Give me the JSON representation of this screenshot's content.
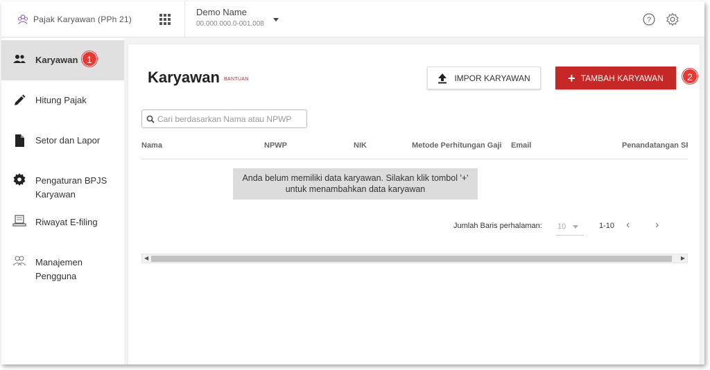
{
  "header": {
    "app_title": "Pajak Karyawan (PPh 21)",
    "company_name": "Demo Name",
    "company_npwp": "00.000.000.0-001.008"
  },
  "sidebar": {
    "items": [
      {
        "label": "Karyawan",
        "icon": "people-icon",
        "active": true,
        "badge": "1"
      },
      {
        "label": "Hitung Pajak",
        "icon": "pencil-icon"
      },
      {
        "label": "Setor dan Lapor",
        "icon": "document-icon"
      },
      {
        "label": "Pengaturan BPJS Karyawan",
        "icon": "gear-icon"
      },
      {
        "label": "Riwayat E-filing",
        "icon": "laptop-icon"
      },
      {
        "label": "Manajemen Pengguna",
        "icon": "users-outline-icon"
      }
    ]
  },
  "main": {
    "title": "Karyawan",
    "help_link": "BANTUAN",
    "import_button": "IMPOR KARYAWAN",
    "add_button": "TAMBAH KARYAWAN",
    "add_badge": "2",
    "search_placeholder": "Cari berdasarkan Nama atau NPWP",
    "columns": [
      "Nama",
      "NPWP",
      "NIK",
      "Metode Perhitungan Gaji",
      "Email",
      "Penandatangan SPT"
    ],
    "empty_message_line1": "Anda belum memiliki data karyawan. Silakan klik tombol '+'",
    "empty_message_line2": "untuk menambahkan data karyawan",
    "pagination": {
      "rows_label": "Jumlah Baris perhalaman:",
      "rows_value": "10",
      "range": "1-10",
      "prev": "‹",
      "next": "›"
    }
  },
  "colors": {
    "accent": "#c62828",
    "badge": "#e53935",
    "active_nav": "#e0e0e0"
  }
}
